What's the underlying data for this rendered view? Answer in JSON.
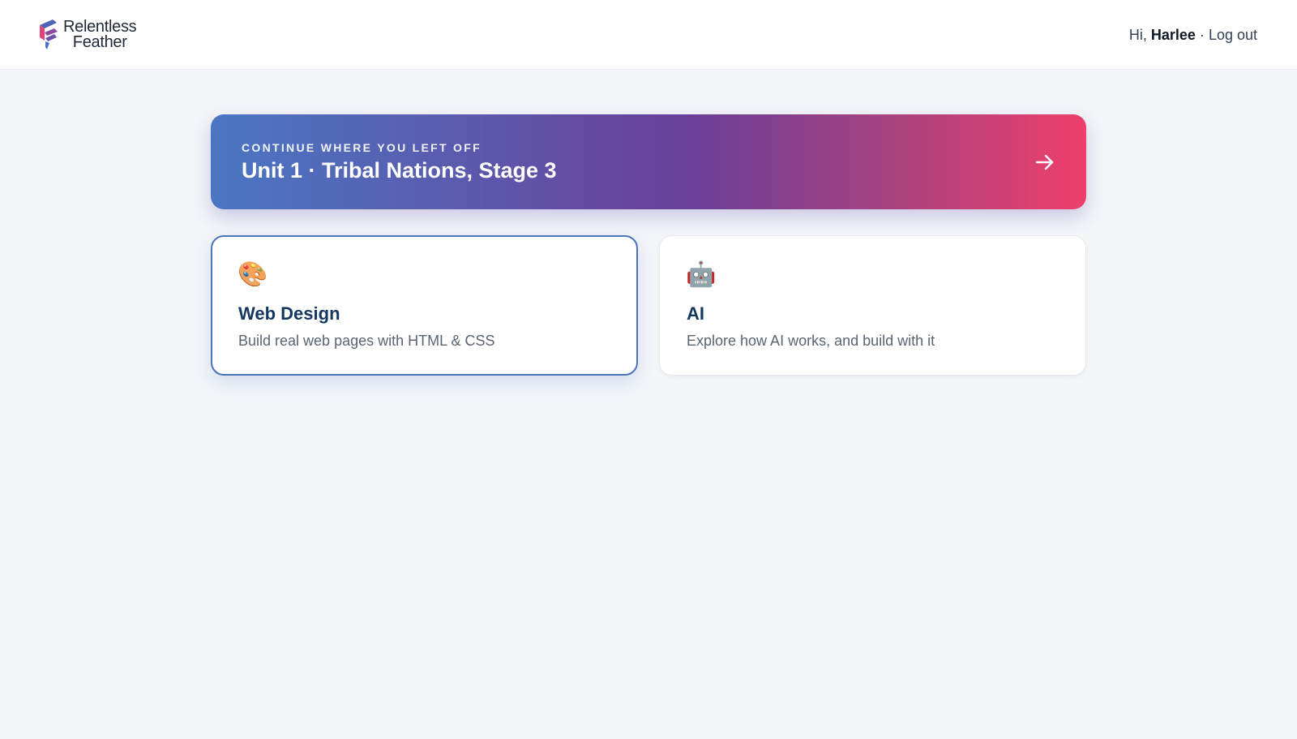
{
  "header": {
    "logo": {
      "line1": "Relentless",
      "line2": "Feather"
    },
    "greeting": "Hi,",
    "user_name": "Harlee",
    "separator": "·",
    "logout_label": "Log out"
  },
  "continue_banner": {
    "eyebrow": "CONTINUE WHERE YOU LEFT OFF",
    "title": "Unit 1 · Tribal Nations, Stage 3",
    "icon": "arrow-right-icon",
    "gradient_colors": [
      "#4a77c4",
      "#6b3f98",
      "#a8427f",
      "#ef3f6b"
    ]
  },
  "courses": [
    {
      "emoji": "🎨",
      "icon": "palette-icon",
      "title": "Web Design",
      "description": "Build real web pages with HTML & CSS",
      "selected": true
    },
    {
      "emoji": "🤖",
      "icon": "robot-icon",
      "title": "AI",
      "description": "Explore how AI works, and build with it",
      "selected": false
    }
  ],
  "colors": {
    "background": "#f3f5f9",
    "selected_border": "#4a73b8",
    "card_title": "#13375f"
  }
}
